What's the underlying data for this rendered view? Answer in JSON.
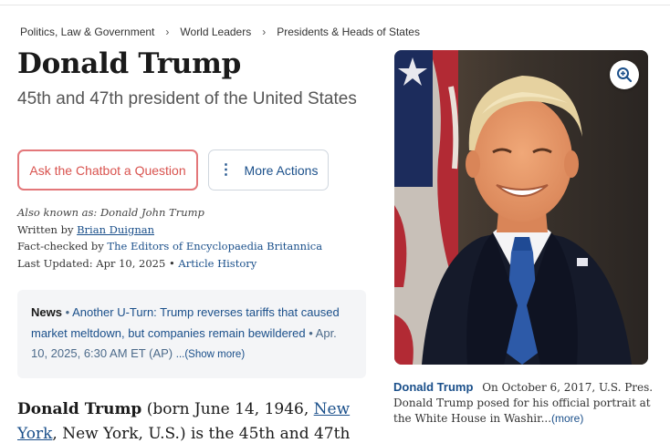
{
  "breadcrumb": [
    "Politics, Law & Government",
    "World Leaders",
    "Presidents & Heads of States"
  ],
  "title": "Donald Trump",
  "subtitle": "45th and 47th president of the United States",
  "actions": {
    "chatbot": "Ask the Chatbot a Question",
    "more": "More Actions"
  },
  "meta": {
    "aka": "Also known as: Donald John Trump",
    "written_by_label": "Written by",
    "author": "Brian Duignan",
    "fact_checked_label": "Fact-checked by",
    "fact_checker": "The Editors of Encyclopaedia Britannica",
    "updated_label": "Last Updated: Apr 10, 2025",
    "bullet": "•",
    "history": "Article History"
  },
  "news": {
    "label": "News",
    "bullet": "•",
    "headline": "Another U-Turn: Trump reverses tariffs that caused market meltdown, but companies remain bewildered",
    "date": "• Apr. 10, 2025, 6:30 AM ET (AP)",
    "show_more": "...(Show more)"
  },
  "intro": {
    "name": "Donald Trump",
    "born": " (born June 14, 1946, ",
    "birthplace_link": "New York",
    "rest": ", New York, U.S.) is the 45th and 47th"
  },
  "image": {
    "caption_name": "Donald Trump",
    "caption_text": "On October 6, 2017, U.S. Pres. Donald Trump posed for his official portrait at the White House in Washir...",
    "caption_more": "(more)",
    "zoom_icon": "zoom-in-icon"
  },
  "colors": {
    "link": "#1a4f8a",
    "chat_button": "#d9534f",
    "news_bg": "#f4f5f7"
  }
}
